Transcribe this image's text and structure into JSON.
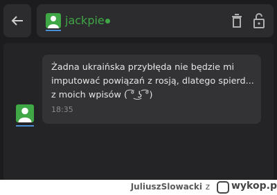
{
  "header": {
    "username": "jackpie",
    "status_color": "#3fa746",
    "icons": [
      "arrow-left-icon",
      "trash-icon",
      "lock-icon"
    ]
  },
  "message": {
    "lines": [
      "Żadna ukraińska przybłęda nie będzie mi",
      "imputować powiązań z rosją, dlatego spierd...",
      "z moich wpisów ( ͡° ͜ʖ ͡°)"
    ],
    "time": "18:35"
  },
  "footer": {
    "author": "JuliuszSlowacki",
    "separator": "z",
    "site": "wykop.pl"
  }
}
